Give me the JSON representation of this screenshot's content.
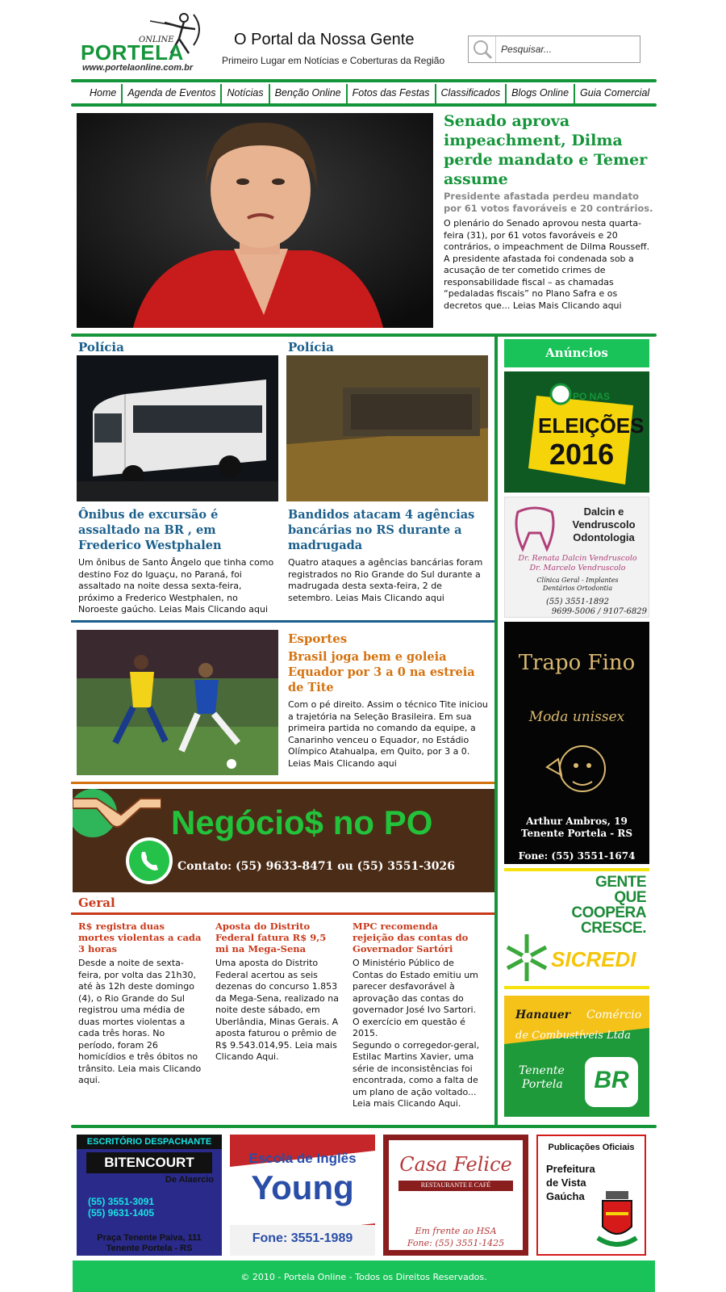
{
  "header": {
    "logo_online": "ONLINE",
    "logo_name": "PORTELA",
    "logo_url": "www.portelaonline.com.br",
    "title": "O Portal da Nossa Gente",
    "subtitle": "Primeiro Lugar em Notícias e Coberturas da Região"
  },
  "search": {
    "placeholder": "Pesquisar..."
  },
  "nav": {
    "items": [
      "Home",
      "Agenda de Eventos",
      "Notícias",
      "Benção Online",
      "Fotos das Festas",
      "Classificados",
      "Blogs Online",
      "Guia Comercial"
    ]
  },
  "hero": {
    "title": "Senado aprova impeachment, Dilma perde mandato e Temer assume",
    "subtitle": "Presidente afastada perdeu mandato por 61 votos favoráveis e 20 contrários.",
    "body": "O plenário do Senado aprovou nesta quarta-feira (31), por 61 votos favoráveis e 20 contrários, o impeachment de Dilma Rousseff. A presidente afastada foi condenada sob a acusação de ter cometido crimes de responsabilidade fiscal – as chamadas “pedaladas fiscais” no Plano Safra e os decretos que... Leias Mais Clicando aqui"
  },
  "police": [
    {
      "section": "Polícia",
      "title": "Ônibus de excursão é assaltado na BR , em Frederico Westphalen",
      "body": "Um ônibus de Santo Ângelo que tinha como destino Foz do Iguaçu, no Paraná, foi assaltado na noite dessa sexta-feira, próximo a Frederico Westphalen, no Noroeste gaúcho.  Leias Mais Clicando aqui"
    },
    {
      "section": "Polícia",
      "title": "Bandidos atacam 4 agências bancárias no RS durante a madrugada",
      "body": "Quatro ataques a agências bancárias foram registrados no Rio Grande do Sul durante a madrugada desta sexta-feira, 2 de setembro. Leias Mais Clicando aqui"
    }
  ],
  "sports": {
    "section": "Esportes",
    "title": "Brasil joga bem e goleia Equador por 3 a 0 na estreia de Tite",
    "body": "Com o pé direito. Assim o técnico Tite iniciou a trajetória na Seleção Brasileira. Em sua primeira partida no comando da equipe, a Canarinho venceu o Equador, no Estádio Olímpico Atahualpa, em Quito, por 3 a 0. Leias Mais Clicando aqui"
  },
  "business_banner": {
    "title": "Negócio$ no PO",
    "contact": "Contato: (55) 9633-8471 ou (55) 3551-3026"
  },
  "general": {
    "section": "Geral",
    "items": [
      {
        "title": "R$ registra duas mortes violentas a cada 3 horas",
        "body": "Desde a noite de sexta-feira, por volta das 21h30, até às 12h deste domingo (4), o Rio Grande do Sul registrou uma média de duas mortes violentas a cada três horas. No período, foram 26 homicídios e três óbitos no trânsito. Leia mais Clicando aqui."
      },
      {
        "title": "Aposta do Distrito Federal fatura R$ 9,5 mi na Mega-Sena",
        "body": "Uma aposta do Distrito Federal acertou as seis dezenas do concurso 1.853 da Mega-Sena, realizado na noite deste sábado, em Uberlândia, Minas Gerais. A aposta faturou o prêmio de R$ 9.543.014,95. Leia mais Clicando Aqui."
      },
      {
        "title": "MPC recomenda rejeição das contas do Governador Sartóri",
        "body": "O Ministério Público de Contas do Estado emitiu um parecer desfavorável à aprovação das contas do governador José Ivo Sartori. O exercício em questão é 2015.\nSegundo o corregedor-geral, Estilac Martins Xavier, uma série de inconsistências foi encontrada, como a falta de um plano de ação voltado... Leia mais Clicando Aqui."
      }
    ]
  },
  "sidebar": {
    "title": "Anúncios",
    "ad_elections": {
      "top": "PO NAS",
      "mid": "ELEIÇÕES",
      "year": "2016"
    },
    "ad_dental": {
      "name": "Dalcin e Vendruscolo Odontologia",
      "doctor1": "Dr. Renata Dalcin Vendruscolo",
      "doctor2": "Dr. Marcelo Vendruscolo",
      "services": "Clínica Geral - Implantes Dentários Ortodontia",
      "phone1": "(55) 3551-1892",
      "phone2": "9699-5006 / 9107-6829"
    },
    "ad_trapo": {
      "name": "Trapo Fino",
      "tagline": "Moda unissex",
      "address1": "Arthur Ambros, 19",
      "address2": "Tenente Portela - RS",
      "phone": "Fone: (55) 3551-1674"
    },
    "ad_sicredi": {
      "line1": "GENTE",
      "line2": "QUE",
      "line3": "COOPERA",
      "line4": "CRESCE.",
      "brand": "SICREDI"
    },
    "ad_fuel": {
      "line1": "Hanauer",
      "line2": "Comércio",
      "line3": "de Combustíveis Ltda",
      "line4": "Tenente",
      "line5": "Portela",
      "brand": "BR"
    }
  },
  "bottom_ads": {
    "bitencourt": {
      "top": "ESCRITÓRIO DESPACHANTE",
      "name": "BITENCOURT",
      "sub": "De Alaercio",
      "phone1": "(55) 3551-3091",
      "phone2": "(55) 9631-1405",
      "addr1": "Praça Tenente Paiva, 111",
      "addr2": "Tenente Portela - RS"
    },
    "young": {
      "line1": "Escola de Inglês",
      "brand": "Young",
      "phone": "Fone: 3551-1989"
    },
    "casa": {
      "name": "Casa Felice",
      "sub": "RESTAURANTE  E CAFÉ",
      "line1": "Em frente ao HSA",
      "phone": "Fone: (55) 3551-1425"
    },
    "prefeitura": {
      "top": "Publicações Oficiais",
      "line1": "Prefeitura",
      "line2": "de Vista",
      "line3": "Gaúcha"
    }
  },
  "footer": {
    "text": "© 2010 - Portela Online - Todos os Direitos Reservados."
  },
  "colors": {
    "green": "#15953a",
    "blue_title": "#1b5f8c",
    "orange": "#d4720f",
    "red": "#c8391a"
  }
}
